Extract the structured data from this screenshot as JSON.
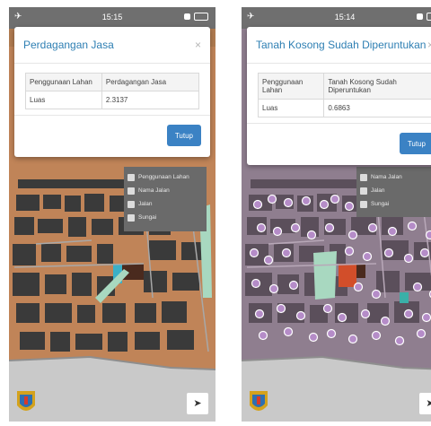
{
  "left": {
    "status": {
      "time": "15:15"
    },
    "modal": {
      "title": "Perdagangan Jasa",
      "close_icon": "×",
      "rows": [
        {
          "key": "Penggunaan Lahan",
          "value": "Perdagangan Jasa"
        },
        {
          "key": "Luas",
          "value": "2.3137"
        }
      ],
      "button": "Tutup"
    },
    "layers": [
      "Penggunaan Lahan",
      "Nama Jalan",
      "Jalan",
      "Sungai"
    ]
  },
  "right": {
    "status": {
      "time": "15:14"
    },
    "modal": {
      "title": "Tanah Kosong Sudah Diperuntukan",
      "close_icon": "×",
      "rows": [
        {
          "key": "Penggunaan Lahan",
          "value": "Tanah Kosong Sudah Diperuntukan"
        },
        {
          "key": "Luas",
          "value": "0.6863"
        }
      ],
      "button": "Tutup"
    },
    "layers": [
      "Nama Jalan",
      "Jalan",
      "Sungai"
    ]
  },
  "icons": {
    "statusbar": "airplane-icon",
    "locate": "navigation-arrow-icon",
    "emblem": "city-emblem-icon"
  },
  "colors": {
    "accent": "#3b82c4",
    "title": "#2e7fb3",
    "map_land": "#c08458",
    "buildings": "#3d3d3d"
  }
}
